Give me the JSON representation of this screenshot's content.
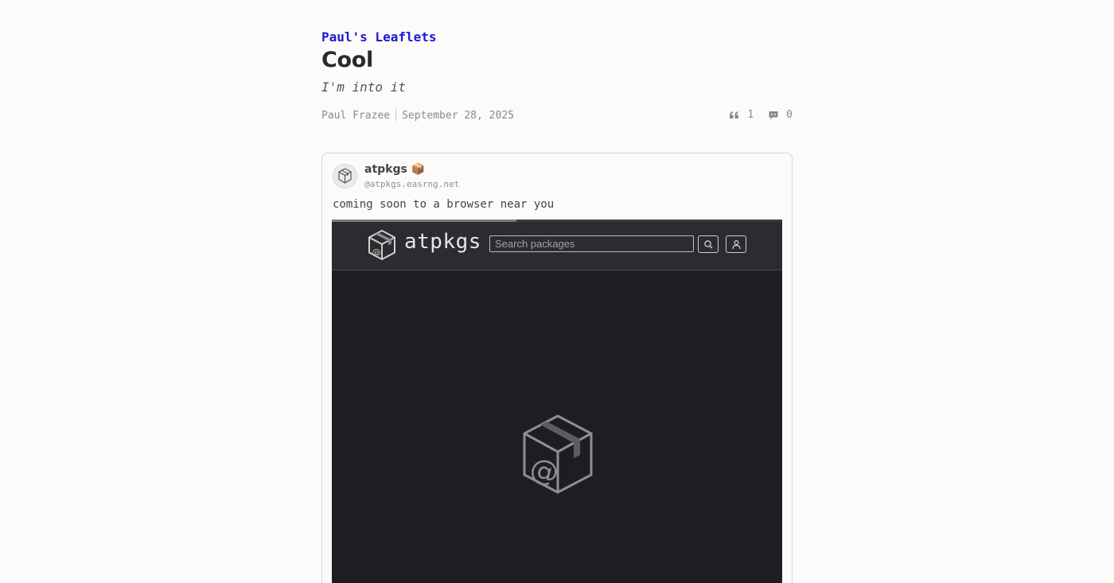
{
  "publication": {
    "name": "Paul's Leaflets"
  },
  "post": {
    "title": "Cool",
    "subtitle": "I'm into it",
    "author": "Paul Frazee",
    "date": "September 28, 2025",
    "quote_count": "1",
    "comment_count": "0",
    "icons": {
      "quotes": "quote-icon",
      "comments": "comment-icon"
    }
  },
  "embed": {
    "author_name": "atpkgs 📦",
    "author_handle": "@atpkgs.easrng.net",
    "text": "coming soon to a browser near you",
    "media": {
      "progress": 0.41,
      "brand": "atpkgs",
      "search_placeholder": "Search packages",
      "icons": {
        "logo": "package-box-icon",
        "search": "search-icon",
        "account": "user-icon"
      },
      "colors": {
        "header": "#2c2b2f",
        "body": "#1e1d21"
      }
    }
  }
}
